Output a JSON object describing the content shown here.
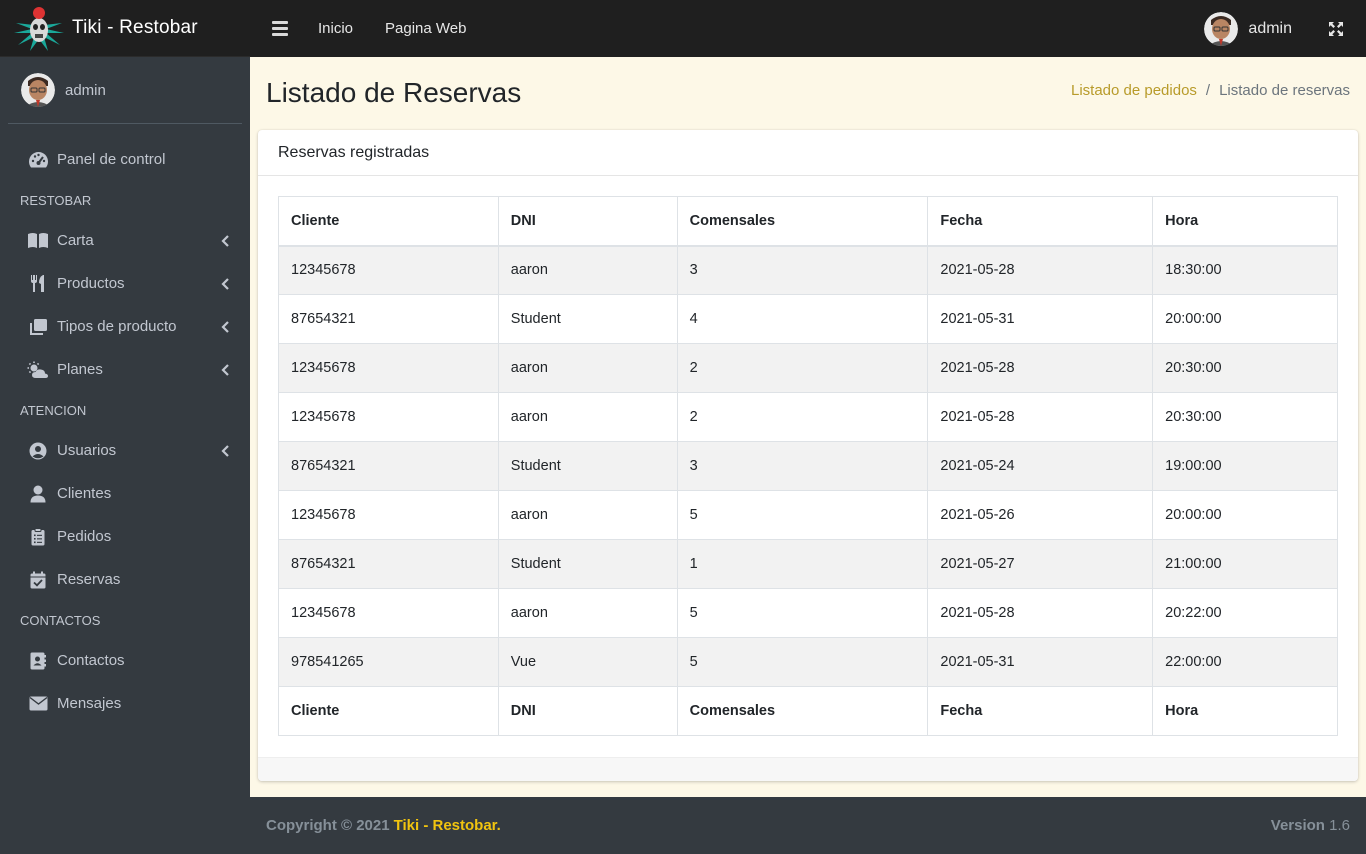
{
  "brand": {
    "name": "Tiki - Restobar"
  },
  "topbar": {
    "links": [
      {
        "label": "Inicio"
      },
      {
        "label": "Pagina Web"
      }
    ],
    "user": "admin"
  },
  "sidebar": {
    "user": "admin",
    "items": [
      {
        "type": "item",
        "label": "Panel de control",
        "icon": "tachometer-icon",
        "chevron": false
      },
      {
        "type": "header",
        "label": "RESTOBAR"
      },
      {
        "type": "item",
        "label": "Carta",
        "icon": "book-open-icon",
        "chevron": true
      },
      {
        "type": "item",
        "label": "Productos",
        "icon": "utensils-icon",
        "chevron": true
      },
      {
        "type": "item",
        "label": "Tipos de producto",
        "icon": "copy-icon",
        "chevron": true
      },
      {
        "type": "item",
        "label": "Planes",
        "icon": "cloud-sun-icon",
        "chevron": true
      },
      {
        "type": "header",
        "label": "ATENCION"
      },
      {
        "type": "item",
        "label": "Usuarios",
        "icon": "user-circle-icon",
        "chevron": true
      },
      {
        "type": "item",
        "label": "Clientes",
        "icon": "user-icon",
        "chevron": false
      },
      {
        "type": "item",
        "label": "Pedidos",
        "icon": "clipboard-list-icon",
        "chevron": false
      },
      {
        "type": "item",
        "label": "Reservas",
        "icon": "calendar-check-icon",
        "chevron": false
      },
      {
        "type": "header",
        "label": "CONTACTOS"
      },
      {
        "type": "item",
        "label": "Contactos",
        "icon": "address-book-icon",
        "chevron": false
      },
      {
        "type": "item",
        "label": "Mensajes",
        "icon": "envelope-icon",
        "chevron": false
      }
    ]
  },
  "page": {
    "title": "Listado de Reservas",
    "breadcrumb": {
      "link": "Listado de pedidos",
      "separator": "/",
      "active": "Listado de reservas"
    }
  },
  "card": {
    "title": "Reservas registradas"
  },
  "table": {
    "columns": [
      "Cliente",
      "DNI",
      "Comensales",
      "Fecha",
      "Hora"
    ],
    "rows": [
      [
        "12345678",
        "aaron",
        "3",
        "2021-05-28",
        "18:30:00"
      ],
      [
        "87654321",
        "Student",
        "4",
        "2021-05-31",
        "20:00:00"
      ],
      [
        "12345678",
        "aaron",
        "2",
        "2021-05-28",
        "20:30:00"
      ],
      [
        "12345678",
        "aaron",
        "2",
        "2021-05-28",
        "20:30:00"
      ],
      [
        "87654321",
        "Student",
        "3",
        "2021-05-24",
        "19:00:00"
      ],
      [
        "12345678",
        "aaron",
        "5",
        "2021-05-26",
        "20:00:00"
      ],
      [
        "87654321",
        "Student",
        "1",
        "2021-05-27",
        "21:00:00"
      ],
      [
        "12345678",
        "aaron",
        "5",
        "2021-05-28",
        "20:22:00"
      ],
      [
        "978541265",
        "Vue",
        "5",
        "2021-05-31",
        "22:00:00"
      ]
    ]
  },
  "footer": {
    "copyright": "Copyright © 2021",
    "brand": "Tiki - Restobar.",
    "version_label": "Version",
    "version": "1.6"
  },
  "colors": {
    "sidebar_bg": "#343a40",
    "topbar_bg": "#1f1f1f",
    "content_bg": "#fdf8e7",
    "breadcrumb_link": "#b89b2a",
    "footer_brand": "#f1c40f"
  }
}
